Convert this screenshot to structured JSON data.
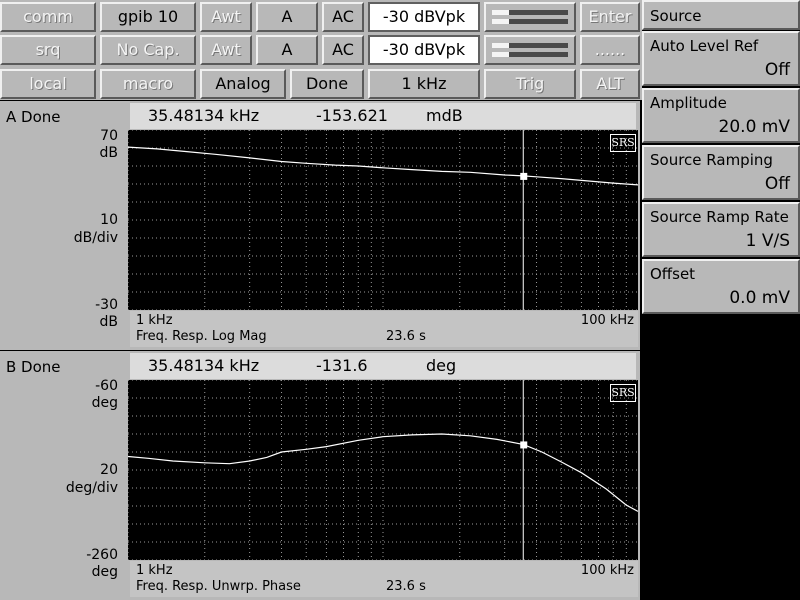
{
  "toolbar": {
    "row1": {
      "comm": "comm",
      "gpib": "gpib 10",
      "awt": "Awt",
      "chan": "A",
      "coupling": "AC",
      "range": "-30 dBVpk",
      "enter": "Enter"
    },
    "row2": {
      "srq": "srq",
      "nocap": "No Cap.",
      "awt": "Awt",
      "chan": "A",
      "coupling": "AC",
      "range": "-30 dBVpk",
      "dots": "......"
    },
    "row3": {
      "local": "local",
      "macro": "macro",
      "analog": "Analog",
      "done": "Done",
      "freq": "1 kHz",
      "trig": "Trig",
      "alt": "ALT"
    },
    "meter_levels": [
      0.22,
      0.22
    ]
  },
  "softkeys": {
    "title": "Source",
    "items": [
      {
        "label": "Auto Level Ref",
        "value": "Off"
      },
      {
        "label": "Amplitude",
        "value": "20.0 mV"
      },
      {
        "label": "Source Ramping",
        "value": "Off"
      },
      {
        "label": "Source Ramp Rate",
        "value": "1 V/S"
      },
      {
        "label": "Offset",
        "value": "0.0 mV"
      }
    ]
  },
  "display_a": {
    "title": "A Done",
    "marker_freq": "35.48134 kHz",
    "marker_value": "-153.621",
    "marker_unit": "mdB",
    "ytop": "70",
    "ytop_unit": "dB",
    "ydiv": "10",
    "ydiv_unit": "dB/div",
    "ybottom": "-30",
    "ybottom_unit": "dB",
    "xstart": "1 kHz",
    "xend": "100 kHz",
    "measurement": "Freq. Resp. Log Mag",
    "time": "23.6 s",
    "logo": "SRS"
  },
  "display_b": {
    "title": "B Done",
    "marker_freq": "35.48134 kHz",
    "marker_value": "-131.6",
    "marker_unit": "deg",
    "ytop": "-60",
    "ytop_unit": "deg",
    "ydiv": "20",
    "ydiv_unit": "deg/div",
    "ybottom": "-260",
    "ybottom_unit": "deg",
    "xstart": "1 kHz",
    "xend": "100 kHz",
    "measurement": "Freq. Resp. Unwrp. Phase",
    "time": "23.6 s",
    "logo": "SRS"
  },
  "chart_data": [
    {
      "type": "line",
      "xscale": "log",
      "xlim": [
        1000,
        100000
      ],
      "ylim": [
        -30,
        70
      ],
      "grid": true,
      "marker_x": 35481.34,
      "series": [
        {
          "x": [
            1000,
            1300,
            1700,
            2200,
            3000,
            4000,
            5000,
            6500,
            8000,
            10000,
            13000,
            17000,
            22000,
            30000,
            35481,
            40000,
            50000,
            60000,
            80000,
            100000
          ],
          "y": [
            60.5,
            59.5,
            58.0,
            56.5,
            54.5,
            52.5,
            51.5,
            50.5,
            50.0,
            49.0,
            48.0,
            47.0,
            46.5,
            45.0,
            44.5,
            44.0,
            43.0,
            42.0,
            40.5,
            39.5
          ]
        }
      ]
    },
    {
      "type": "line",
      "xscale": "log",
      "xlim": [
        1000,
        100000
      ],
      "ylim": [
        -260,
        -60
      ],
      "grid": true,
      "marker_x": 35481.34,
      "series": [
        {
          "x": [
            1000,
            1200,
            1500,
            2000,
            2500,
            3000,
            3500,
            4000,
            5000,
            6000,
            8000,
            10000,
            13000,
            17000,
            22000,
            28000,
            35481,
            42000,
            50000,
            60000,
            75000,
            90000,
            100000
          ],
          "y": [
            -145,
            -147,
            -150,
            -152,
            -153,
            -150,
            -146,
            -140,
            -137,
            -134,
            -127,
            -123,
            -121,
            -120,
            -122,
            -126,
            -131.6,
            -140,
            -151,
            -163,
            -181,
            -199,
            -206
          ]
        }
      ]
    }
  ]
}
